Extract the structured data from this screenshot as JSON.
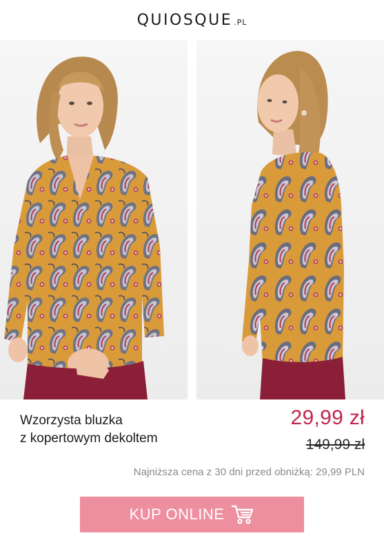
{
  "brand": {
    "name": "QUIOSQUE",
    "tld": ".PL"
  },
  "images": {
    "front": "model-front-icon",
    "side": "model-side-icon"
  },
  "product": {
    "title_line1": "Wzorzysta bluzka",
    "title_line2": "z kopertowym dekoltem",
    "price_current": "29,99 zł",
    "price_old": "149,99 zł",
    "lowest_price_note": "Najniższa cena z 30 dni przed obniżką: 29,99 PLN"
  },
  "cta": {
    "label": "KUP ONLINE",
    "icon": "cart-icon"
  },
  "colors": {
    "price_accent": "#c2244d",
    "button_bg": "#ee8fa0",
    "blouse_mustard": "#d99a3a",
    "skirt_burgundy": "#8a1f37"
  }
}
